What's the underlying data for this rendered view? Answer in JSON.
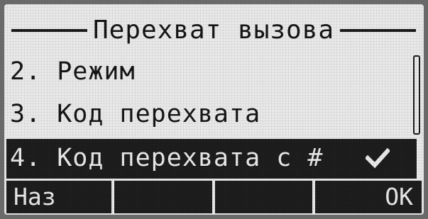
{
  "screen": {
    "title": "Перехват вызова",
    "items": [
      {
        "label": "2. Режим"
      },
      {
        "label": "3. Код перехвата"
      },
      {
        "label": "4. Код перехвата с #",
        "selected": true,
        "checked": true,
        "icon": "check-icon"
      }
    ],
    "softkeys": [
      "Наз",
      "",
      "",
      "OK"
    ]
  },
  "colors": {
    "lcd_background": "#e9e9e9",
    "ink": "#151515",
    "highlight": "#1d1d1d",
    "highlight_text": "#eaeaea"
  }
}
